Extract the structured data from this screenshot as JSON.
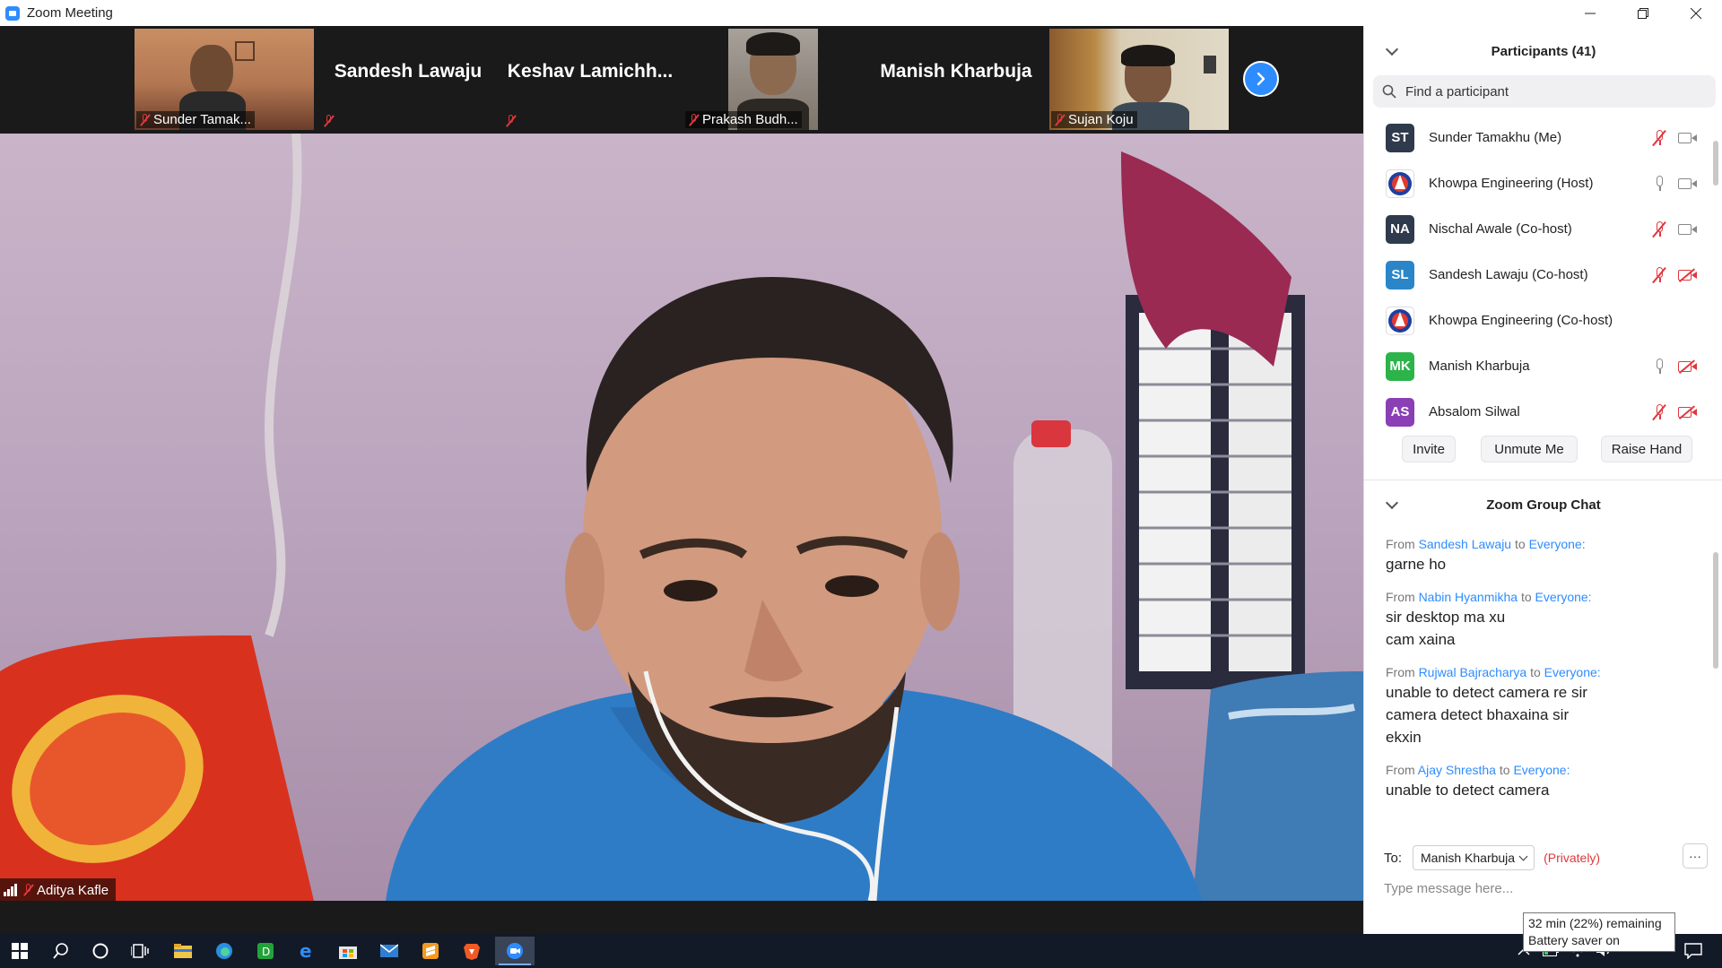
{
  "window": {
    "title": "Zoom Meeting",
    "controls": [
      "minimize",
      "restore",
      "close"
    ]
  },
  "gallery": {
    "tiles": [
      {
        "name": "Sunder Tamak...",
        "video": true,
        "muted": true
      },
      {
        "name": "Sandesh Lawaju",
        "video": false,
        "muted": true
      },
      {
        "name": "Keshav  Lamichh...",
        "video": false,
        "muted": true
      },
      {
        "name": "Prakash Budh...",
        "video": true,
        "muted": true
      },
      {
        "name": "Manish Kharbuja",
        "video": false,
        "muted": false
      },
      {
        "name": "Sujan Koju",
        "video": true,
        "muted": true
      }
    ],
    "next_icon": "chevron-right-icon"
  },
  "main_speaker": {
    "name": "Aditya Kafle",
    "muted": true
  },
  "participants": {
    "title": "Participants (41)",
    "search_placeholder": "Find a participant",
    "items": [
      {
        "initials": "ST",
        "name": "Sunder Tamakhu (Me)",
        "color": "#2f3b4c",
        "mic": "muted",
        "cam": "on"
      },
      {
        "initials": "",
        "name": "Khowpa Engineering (Host)",
        "color": "#ffffff",
        "mic": "on",
        "cam": "on",
        "logo": true
      },
      {
        "initials": "NA",
        "name": "Nischal Awale (Co-host)",
        "color": "#2f3b4c",
        "mic": "muted",
        "cam": "on"
      },
      {
        "initials": "SL",
        "name": "Sandesh Lawaju (Co-host)",
        "color": "#2a86c8",
        "mic": "muted",
        "cam": "off"
      },
      {
        "initials": "",
        "name": "Khowpa Engineering (Co-host)",
        "color": "#ffffff",
        "mic": "none",
        "cam": "none",
        "logo": true
      },
      {
        "initials": "MK",
        "name": "Manish Kharbuja",
        "color": "#2cb34a",
        "mic": "on",
        "cam": "off"
      },
      {
        "initials": "AS",
        "name": "Absalom Silwal",
        "color": "#8a3fb5",
        "mic": "muted",
        "cam": "off"
      }
    ],
    "buttons": {
      "invite": "Invite",
      "unmute": "Unmute Me",
      "raise_hand": "Raise Hand"
    }
  },
  "chat": {
    "title": "Zoom Group Chat",
    "messages": [
      {
        "from_label": "From",
        "sender": "Sandesh Lawaju",
        "to_label": "to",
        "recipient": "Everyone:",
        "lines": [
          "garne ho"
        ]
      },
      {
        "from_label": "From",
        "sender": "Nabin Hyanmikha",
        "to_label": "to",
        "recipient": "Everyone:",
        "lines": [
          "sir desktop ma xu",
          "cam xaina"
        ]
      },
      {
        "from_label": "From",
        "sender": "Rujwal Bajracharya",
        "to_label": "to",
        "recipient": "Everyone:",
        "lines": [
          "unable to detect camera re sir",
          "camera detect bhaxaina sir",
          "ekxin"
        ]
      },
      {
        "from_label": "From",
        "sender": "Ajay Shrestha",
        "to_label": "to",
        "recipient": "Everyone:",
        "lines": [
          "unable to detect camera"
        ]
      }
    ],
    "to_label": "To:",
    "recipient_select": "Manish Kharbuja",
    "privately": "(Privately)",
    "more": "···",
    "input_placeholder": "Type message here..."
  },
  "taskbar": {
    "apps": [
      "start-icon",
      "search-icon",
      "cortana-icon",
      "task-view-icon",
      "file-explorer-icon",
      "edge-chromium-icon",
      "app-d-icon",
      "edge-icon",
      "store-icon",
      "mail-icon",
      "sublime-icon",
      "brave-icon",
      "zoom-icon"
    ],
    "tooltip_lines": [
      "32 min (22%) remaining",
      "Battery saver on"
    ]
  }
}
